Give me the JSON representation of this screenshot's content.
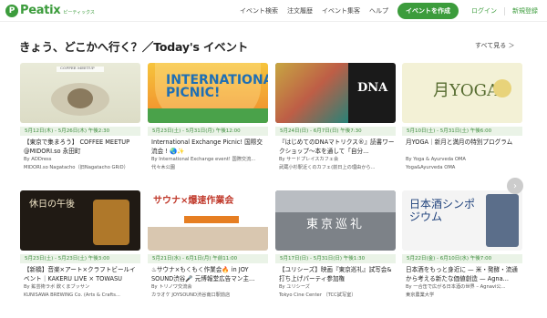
{
  "header": {
    "logo_text": "Peatix",
    "logo_sub": "ピーティックス",
    "nav": [
      "イベント検索",
      "注文履歴",
      "イベント集客",
      "ヘルプ"
    ],
    "create_button": "イベントを作成",
    "login": "ログイン",
    "signup": "新規登録",
    "colors": {
      "brand": "#3c9c3c"
    }
  },
  "section": {
    "title": "きょう、どこかへ行く？／Today's イベント",
    "see_all": "すべて見る ＞"
  },
  "events": [
    {
      "date": "5月12日(木) - 5月26日(木) 午後2:30",
      "title": "【東京で集まろう】 COFFEE MEETUP @MIDORI.so 永田町",
      "organizer": "By ADDress",
      "venue": "MIDORI.so Nagatacho（旧Nagatacho GRiD）",
      "thumb_text": "COFFEE MEETUP"
    },
    {
      "date": "5月23日(土) - 5月31日(月) 午後12:00",
      "title": "International Exchange Picnic! 国際交流会 ! 🌏✨",
      "organizer": "By International Exchange event! 国際交流...",
      "venue": "代々木公園",
      "thumb_text": "INTERNATIONAL PICNIC!"
    },
    {
      "date": "5月24日(日) - 6月7日(日) 午後7:30",
      "title": "『はじめてのDNAマトリクス®』読書ワークショップ〜本を通して「自分...",
      "organizer": "By サードプレイスカフェ会",
      "venue": "武蔵小杉駅近くのカフェ(前日上の理由から...",
      "thumb_text": "DNA"
    },
    {
      "date": "5月10日(土) - 5月31日(土) 午後6:00",
      "title": "月YOGA｜新月と満月の特別プログラム",
      "organizer": "By Yoga & Ayurveda OMA",
      "venue": "Yoga&Ayurveda OMA",
      "thumb_text": "月YOGA"
    },
    {
      "date": "5月23日(土) - 5月23日(土) 午後3:00",
      "title": "【新橋】音楽×アート×クラフトビールイベント｜KAKERU LIVE × TOWASU",
      "organizer": "By 鉱芸術ラボ 飲くまブッサン",
      "venue": "KUNISAWA BREWING Co. (Arts & Crafts...",
      "thumb_text": "休日の午後"
    },
    {
      "date": "5月21日(水) - 6月1日(月) 午前11:00",
      "title": "♨サウナ×もくもく作業会🔥 in JOY SOUND渋谷🎤 元博報堂広告マン主...",
      "organizer": "By トリノワ交流会",
      "venue": "カラオケ JOYSOUND渋谷南口駅前店",
      "thumb_text": "サウナ×爆速作業会"
    },
    {
      "date": "5月17日(日) - 5月31日(日) 午後1:30",
      "title": "【ユリシーズ】映画『東京巡礼』試写会&打ち上げパーティ参加権",
      "organizer": "By ユリシーズ",
      "venue": "Tokyo Cine Center （TCC試写室）",
      "thumb_text": "東京巡礼"
    },
    {
      "date": "5月22日(金) - 6月10日(水) 午後7:00",
      "title": "日本酒をもっと身近に — 米・発酵・流通から考える新たな価値創造 — Agna...",
      "organizer": "By 一合缶で広がる日本酒の世界 – Agnavi公...",
      "venue": "東京農業大学",
      "thumb_text": "日本酒シンポジウム"
    }
  ],
  "carousel_next": "›"
}
